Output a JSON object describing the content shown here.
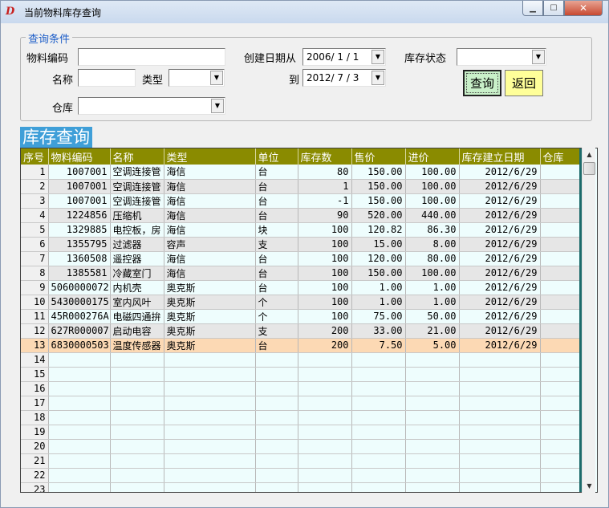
{
  "window": {
    "title": "当前物料库存查询",
    "icon": "app-logo-icon",
    "controls": {
      "minimize": "▁",
      "maximize": "☐",
      "close": "✕"
    }
  },
  "filters": {
    "group_title": "查询条件",
    "material_code_label": "物料编码",
    "material_code_value": "",
    "name_label": "名称",
    "name_value": "",
    "type_label": "类型",
    "type_value": "",
    "warehouse_label": "仓库",
    "warehouse_value": "",
    "date_from_label": "创建日期从",
    "date_from_value": "2006/ 1 / 1",
    "date_to_label": "到",
    "date_to_value": "2012/ 7 / 3",
    "status_label": "库存状态",
    "status_value": ""
  },
  "buttons": {
    "query": "查询",
    "back": "返回"
  },
  "section_title": "库存查询",
  "table": {
    "columns": [
      "序号",
      "物料编码",
      "名称",
      "类型",
      "单位",
      "库存数",
      "售价",
      "进价",
      "库存建立日期",
      "仓库"
    ],
    "rows": [
      [
        "1",
        "1007001",
        "空调连接管",
        "海信",
        "台",
        "80",
        "150.00",
        "100.00",
        "2012/6/29",
        ""
      ],
      [
        "2",
        "1007001",
        "空调连接管",
        "海信",
        "台",
        "1",
        "150.00",
        "100.00",
        "2012/6/29",
        ""
      ],
      [
        "3",
        "1007001",
        "空调连接管",
        "海信",
        "台",
        "-1",
        "150.00",
        "100.00",
        "2012/6/29",
        ""
      ],
      [
        "4",
        "1224856",
        "压缩机",
        "海信",
        "台",
        "90",
        "520.00",
        "440.00",
        "2012/6/29",
        ""
      ],
      [
        "5",
        "1329885",
        "电控板，房",
        "海信",
        "块",
        "100",
        "120.82",
        "86.30",
        "2012/6/29",
        ""
      ],
      [
        "6",
        "1355795",
        "过滤器",
        "容声",
        "支",
        "100",
        "15.00",
        "8.00",
        "2012/6/29",
        ""
      ],
      [
        "7",
        "1360508",
        "遥控器",
        "海信",
        "台",
        "100",
        "120.00",
        "80.00",
        "2012/6/29",
        ""
      ],
      [
        "8",
        "1385581",
        "冷藏室门",
        "海信",
        "台",
        "100",
        "150.00",
        "100.00",
        "2012/6/29",
        ""
      ],
      [
        "9",
        "5060000072",
        "内机壳",
        "奥克斯",
        "台",
        "100",
        "1.00",
        "1.00",
        "2012/6/29",
        ""
      ],
      [
        "10",
        "5430000175",
        "室内风叶",
        "奥克斯",
        "个",
        "100",
        "1.00",
        "1.00",
        "2012/6/29",
        ""
      ],
      [
        "11",
        "45R000276A",
        "电磁四通拚",
        "奥克斯",
        "个",
        "100",
        "75.00",
        "50.00",
        "2012/6/29",
        ""
      ],
      [
        "12",
        "627R000007",
        "启动电容",
        "奥克斯",
        "支",
        "200",
        "33.00",
        "21.00",
        "2012/6/29",
        ""
      ],
      [
        "13",
        "6830000503",
        "温度传感器",
        "奥克斯",
        "台",
        "200",
        "7.50",
        "5.00",
        "2012/6/29",
        ""
      ]
    ],
    "empty_rows": [
      "14",
      "15",
      "16",
      "17",
      "18",
      "19",
      "20",
      "21",
      "22",
      "23"
    ],
    "selected_row_index": 12
  },
  "scrollbar": {
    "up_icon": "▲",
    "down_icon": "▼"
  },
  "colors": {
    "header_bg": "#8a8b00",
    "selected_row": "#fcd9b4",
    "alt_row": "#e6e6e6",
    "row_bg": "#eefdfd",
    "section_title_bg": "#3f9fd8",
    "query_button_bg": "#c9f0c9",
    "back_button_bg": "#ffff99"
  }
}
